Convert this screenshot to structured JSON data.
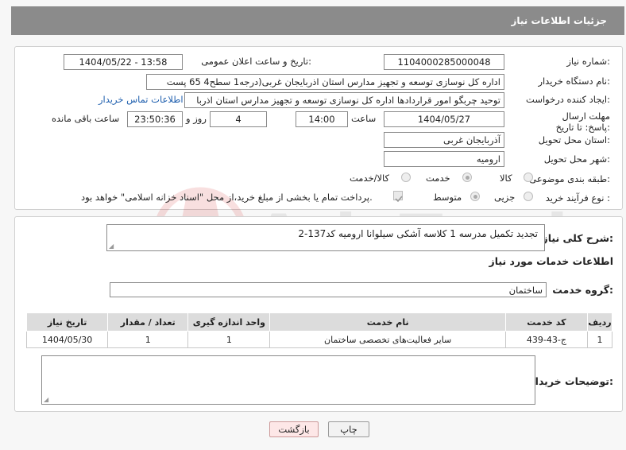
{
  "header": {
    "title": "جزئیات اطلاعات نیاز"
  },
  "watermark": {
    "text": "AriaTender.neT"
  },
  "fields": {
    "need_number_label": "شماره نیاز:",
    "need_number": "1104000285000048",
    "announce_label": "تاریخ و ساعت اعلان عمومی:",
    "announce_value": "1404/05/22 - 13:58",
    "buyer_org_label": "نام دستگاه خریدار:",
    "buyer_org": "اداره کل نوسازی   توسعه و تجهیز مدارس استان اذربایجان غربی(درجه1  سطح4  65 پست",
    "creator_label": "ایجاد کننده درخواست:",
    "creator": "توحید چربگو امور قراردادها اداره کل نوسازی   توسعه و تجهیز مدارس استان اذربا",
    "contact_link": "اطلاعات تماس خریدار",
    "deadline_label": "مهلت ارسال پاسخ: تا تاریخ:",
    "deadline_date": "1404/05/27",
    "time_label": "ساعت",
    "deadline_time": "14:00",
    "days_value": "4",
    "days_label": "روز و",
    "remaining_time": "23:50:36",
    "remaining_label": "ساعت باقی مانده",
    "province_label": "استان محل تحویل:",
    "province": "آذربایجان غربی",
    "city_label": "شهر محل تحویل:",
    "city": "ارومیه",
    "category_label": "طبقه بندی موضوعی:",
    "category_options": [
      "کالا",
      "خدمت",
      "کالا/خدمت"
    ],
    "category_selected": "خدمت",
    "process_label": "نوع فرآیند خرید :",
    "process_options": [
      "جزیی",
      "متوسط"
    ],
    "process_selected": "متوسط",
    "payment_text": "پرداخت تمام یا بخشی از مبلغ خرید،از محل \"اسناد خزانه اسلامی\" خواهد بود."
  },
  "summary": {
    "label": "شرح کلی نیاز:",
    "text": "تجدید تکمیل مدرسه 1 کلاسه آشکی سیلوانا ارومیه کد137-2"
  },
  "services": {
    "title": "اطلاعات خدمات مورد نیاز",
    "group_label": "گروه خدمت:",
    "group_value": "ساختمان",
    "columns": [
      "ردیف",
      "کد خدمت",
      "نام خدمت",
      "واحد اندازه گیری",
      "تعداد / مقدار",
      "تاریخ نیاز"
    ],
    "rows": [
      [
        "1",
        "ج-43-439",
        "سایر فعالیت‌های تخصصی ساختمان",
        "1",
        "1",
        "1404/05/30"
      ]
    ]
  },
  "buyer_notes": {
    "label": "توضیحات خریدار:"
  },
  "buttons": {
    "print": "چاپ",
    "back": "بازگشت"
  }
}
